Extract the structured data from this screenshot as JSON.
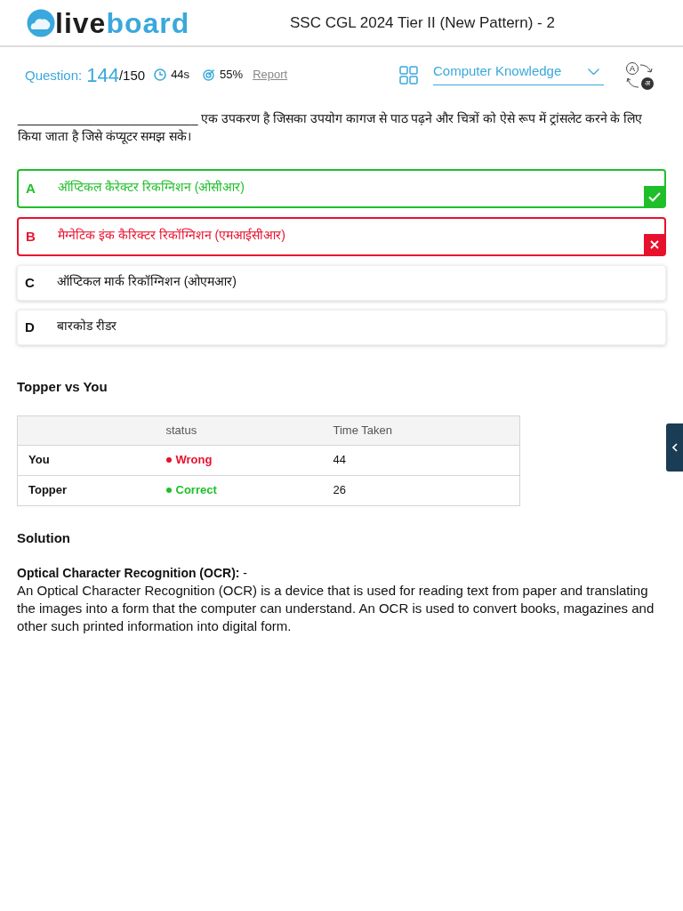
{
  "header": {
    "logo": {
      "dark": "live",
      "accent": "board"
    },
    "title": "SSC CGL 2024 Tier II (New Pattern) - 2"
  },
  "question_bar": {
    "label": "Question:",
    "number": "144",
    "total": "/150",
    "time": "44s",
    "accuracy": "55%",
    "report": "Report",
    "section": "Computer Knowledge",
    "language_toggle": {
      "from": "A",
      "to": "अ"
    }
  },
  "question": {
    "text": "__________________________ एक उपकरण है जिसका उपयोग कागज से पाठ पढ़ने और चित्रों को ऐसे रूप में ट्रांसलेट करने के लिए किया जाता है जिसे कंप्यूटर समझ सके।",
    "options": [
      {
        "letter": "A",
        "text": "ऑप्टिकल कैरेक्टर रिकग्निशन (ओसीआर)",
        "kind": "correct"
      },
      {
        "letter": "B",
        "text": "मैग्नेटिक इंक कैरिक्टर रिकॉग्निशन (एमआईसीआर)",
        "kind": "wrong"
      },
      {
        "letter": "C",
        "text": "ऑप्टिकल मार्क रिकॉग्निशन (ओएमआर)",
        "kind": "plain"
      },
      {
        "letter": "D",
        "text": "बारकोड रीडर",
        "kind": "plain"
      }
    ]
  },
  "comparison": {
    "title": "Topper vs You",
    "columns": [
      "status",
      "Time Taken"
    ],
    "rows": [
      {
        "name": "You",
        "status": "Wrong",
        "color": "#e8112d",
        "time": "44"
      },
      {
        "name": "Topper",
        "status": "Correct",
        "color": "#1fbf2a",
        "time": "26"
      }
    ]
  },
  "solution": {
    "title": "Solution",
    "heading": "**Optical Character Recognition (OCR):** -",
    "body": "An Optical Character Recognition (OCR) is a device that is used for reading text from paper and translating the images into a form that the computer can understand. An OCR is used to convert books, magazines and other such printed information into digital form."
  }
}
